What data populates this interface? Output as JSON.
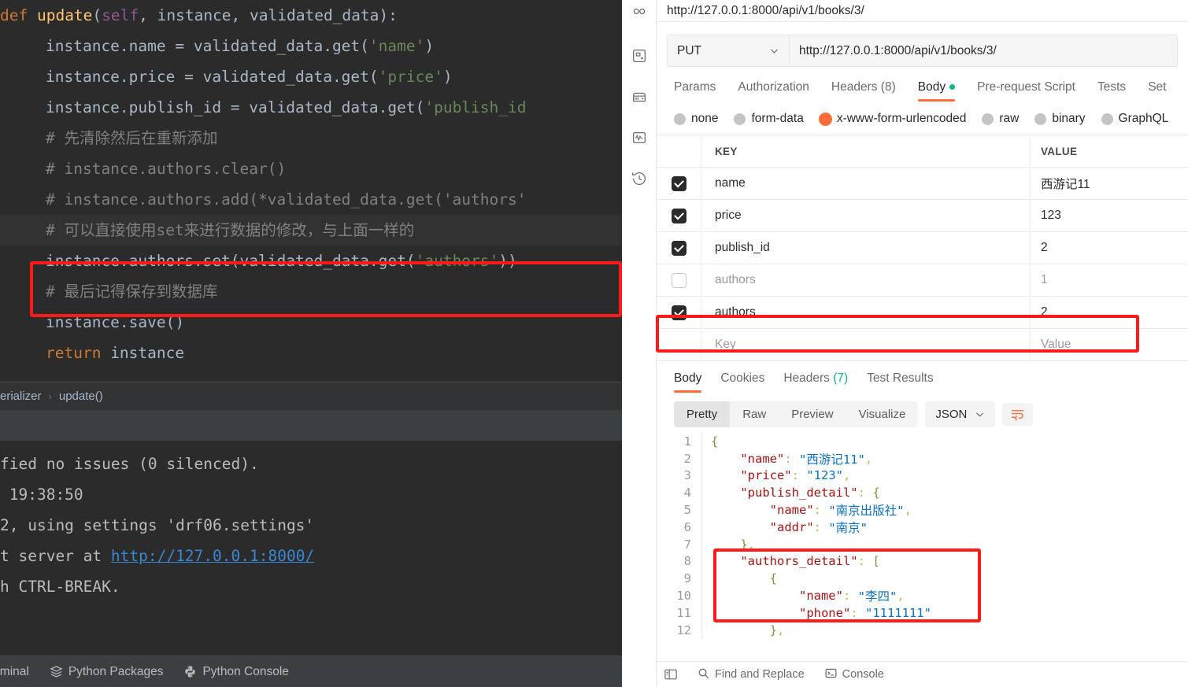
{
  "ide": {
    "code_lines": [
      {
        "indent": 0,
        "tokens": [
          {
            "t": "def ",
            "c": "kw"
          },
          {
            "t": "update",
            "c": "fn"
          },
          {
            "t": "(",
            "c": "pun"
          },
          {
            "t": "self",
            "c": "self"
          },
          {
            "t": ", instance, validated_data):",
            "c": "txt"
          }
        ]
      },
      {
        "indent": 1,
        "tokens": [
          {
            "t": "instance.name = validated_data.get(",
            "c": "txt"
          },
          {
            "t": "'name'",
            "c": "str"
          },
          {
            "t": ")",
            "c": "txt"
          }
        ]
      },
      {
        "indent": 1,
        "tokens": [
          {
            "t": "instance.price = validated_data.get(",
            "c": "txt"
          },
          {
            "t": "'price'",
            "c": "str"
          },
          {
            "t": ")",
            "c": "txt"
          }
        ]
      },
      {
        "indent": 1,
        "tokens": [
          {
            "t": "instance.publish_id = validated_data.get(",
            "c": "txt"
          },
          {
            "t": "'publish_id",
            "c": "str"
          }
        ]
      },
      {
        "indent": 1,
        "tokens": [
          {
            "t": "# 先清除然后在重新添加",
            "c": "cmt"
          }
        ]
      },
      {
        "indent": 1,
        "tokens": [
          {
            "t": "# instance.authors.clear()",
            "c": "cmt"
          }
        ]
      },
      {
        "indent": 1,
        "tokens": [
          {
            "t": "# instance.authors.add(*validated_data.get('authors'",
            "c": "cmt"
          }
        ]
      },
      {
        "indent": 1,
        "highlight": true,
        "tokens": [
          {
            "t": "# 可以直接使用set来进行数据的修改，与上面一样的",
            "c": "cmt"
          }
        ]
      },
      {
        "indent": 1,
        "tokens": [
          {
            "t": "instance.authors.set(validated_data.get(",
            "c": "txt"
          },
          {
            "t": "'authors'",
            "c": "str"
          },
          {
            "t": "))",
            "c": "txt"
          }
        ]
      },
      {
        "indent": 1,
        "tokens": [
          {
            "t": "# 最后记得保存到数据库",
            "c": "cmt"
          }
        ]
      },
      {
        "indent": 1,
        "tokens": [
          {
            "t": "instance.save()",
            "c": "txt"
          }
        ]
      },
      {
        "indent": 1,
        "tokens": [
          {
            "t": "return ",
            "c": "kw"
          },
          {
            "t": "instance",
            "c": "txt"
          }
        ]
      }
    ],
    "breadcrumb": {
      "parent": "erializer",
      "current": "update()"
    },
    "console_lines": [
      {
        "segments": [
          {
            "t": "fied no issues (0 silenced).",
            "link": false
          }
        ]
      },
      {
        "segments": [
          {
            "t": " 19:38:50",
            "link": false
          }
        ]
      },
      {
        "segments": [
          {
            "t": "2, using settings 'drf06.settings'",
            "link": false
          }
        ]
      },
      {
        "segments": [
          {
            "t": "t server at ",
            "link": false
          },
          {
            "t": "http://127.0.0.1:8000/",
            "link": true
          }
        ]
      },
      {
        "segments": [
          {
            "t": "h CTRL-BREAK.",
            "link": false
          }
        ]
      }
    ],
    "status_items": [
      {
        "label": "erminal",
        "icon": "terminal-icon"
      },
      {
        "label": "Python Packages",
        "icon": "packages-icon"
      },
      {
        "label": "Python Console",
        "icon": "python-icon"
      }
    ]
  },
  "postman": {
    "rail_icons": [
      "collections-icon",
      "api-icon",
      "environments-icon",
      "monitor-icon",
      "history-icon"
    ],
    "url_title": "http://127.0.0.1:8000/api/v1/books/3/",
    "request": {
      "method": "PUT",
      "url": "http://127.0.0.1:8000/api/v1/books/3/",
      "tabs": [
        {
          "label": "Params",
          "active": false
        },
        {
          "label": "Authorization",
          "active": false
        },
        {
          "label": "Headers",
          "count": "(8)",
          "active": false
        },
        {
          "label": "Body",
          "active": true,
          "dot": true
        },
        {
          "label": "Pre-request Script",
          "active": false
        },
        {
          "label": "Tests",
          "active": false
        },
        {
          "label": "Set",
          "active": false
        }
      ],
      "body_types": [
        {
          "label": "none",
          "selected": false
        },
        {
          "label": "form-data",
          "selected": false
        },
        {
          "label": "x-www-form-urlencoded",
          "selected": true
        },
        {
          "label": "raw",
          "selected": false
        },
        {
          "label": "binary",
          "selected": false
        },
        {
          "label": "GraphQL",
          "selected": false
        }
      ],
      "table": {
        "headers": {
          "key": "KEY",
          "value": "VALUE"
        },
        "rows": [
          {
            "checked": true,
            "key": "name",
            "value": "西游记11",
            "muted": false,
            "highlight": false
          },
          {
            "checked": true,
            "key": "price",
            "value": "123",
            "muted": false,
            "highlight": false
          },
          {
            "checked": true,
            "key": "publish_id",
            "value": "2",
            "muted": false,
            "highlight": false
          },
          {
            "checked": false,
            "key": "authors",
            "value": "1",
            "muted": true,
            "highlight": false
          },
          {
            "checked": true,
            "key": "authors",
            "value": "2",
            "muted": false,
            "highlight": true
          }
        ],
        "placeholder_row": {
          "key": "Key",
          "value": "Value"
        }
      }
    },
    "response": {
      "tabs": [
        {
          "label": "Body",
          "active": true
        },
        {
          "label": "Cookies",
          "active": false
        },
        {
          "label": "Headers",
          "count": "(7)",
          "active": false
        },
        {
          "label": "Test Results",
          "active": false
        }
      ],
      "view_modes": [
        {
          "label": "Pretty",
          "active": true
        },
        {
          "label": "Raw",
          "active": false
        },
        {
          "label": "Preview",
          "active": false
        },
        {
          "label": "Visualize",
          "active": false
        }
      ],
      "format_select": "JSON",
      "wrap_icon": "wrap-lines-icon",
      "json_lines": [
        {
          "n": "1",
          "segments": [
            {
              "t": "{",
              "c": "brk"
            }
          ]
        },
        {
          "n": "2",
          "segments": [
            {
              "t": "    ",
              "c": "pun"
            },
            {
              "t": "\"name\"",
              "c": "key"
            },
            {
              "t": ": ",
              "c": "pun"
            },
            {
              "t": "\"西游记11\"",
              "c": "str"
            },
            {
              "t": ",",
              "c": "pun"
            }
          ]
        },
        {
          "n": "3",
          "segments": [
            {
              "t": "    ",
              "c": "pun"
            },
            {
              "t": "\"price\"",
              "c": "key"
            },
            {
              "t": ": ",
              "c": "pun"
            },
            {
              "t": "\"123\"",
              "c": "str"
            },
            {
              "t": ",",
              "c": "pun"
            }
          ]
        },
        {
          "n": "4",
          "segments": [
            {
              "t": "    ",
              "c": "pun"
            },
            {
              "t": "\"publish_detail\"",
              "c": "key"
            },
            {
              "t": ": ",
              "c": "pun"
            },
            {
              "t": "{",
              "c": "brk"
            }
          ]
        },
        {
          "n": "5",
          "segments": [
            {
              "t": "        ",
              "c": "pun"
            },
            {
              "t": "\"name\"",
              "c": "key"
            },
            {
              "t": ": ",
              "c": "pun"
            },
            {
              "t": "\"南京出版社\"",
              "c": "str"
            },
            {
              "t": ",",
              "c": "pun"
            }
          ]
        },
        {
          "n": "6",
          "segments": [
            {
              "t": "        ",
              "c": "pun"
            },
            {
              "t": "\"addr\"",
              "c": "key"
            },
            {
              "t": ": ",
              "c": "pun"
            },
            {
              "t": "\"南京\"",
              "c": "str"
            }
          ]
        },
        {
          "n": "7",
          "segments": [
            {
              "t": "    ",
              "c": "pun"
            },
            {
              "t": "}",
              "c": "brk"
            },
            {
              "t": ",",
              "c": "pun"
            }
          ]
        },
        {
          "n": "8",
          "segments": [
            {
              "t": "    ",
              "c": "pun"
            },
            {
              "t": "\"authors_detail\"",
              "c": "key"
            },
            {
              "t": ": ",
              "c": "pun"
            },
            {
              "t": "[",
              "c": "brk"
            }
          ]
        },
        {
          "n": "9",
          "segments": [
            {
              "t": "        ",
              "c": "pun"
            },
            {
              "t": "{",
              "c": "brk"
            }
          ]
        },
        {
          "n": "10",
          "segments": [
            {
              "t": "            ",
              "c": "pun"
            },
            {
              "t": "\"name\"",
              "c": "key"
            },
            {
              "t": ": ",
              "c": "pun"
            },
            {
              "t": "\"李四\"",
              "c": "str"
            },
            {
              "t": ",",
              "c": "pun"
            }
          ]
        },
        {
          "n": "11",
          "segments": [
            {
              "t": "            ",
              "c": "pun"
            },
            {
              "t": "\"phone\"",
              "c": "key"
            },
            {
              "t": ": ",
              "c": "pun"
            },
            {
              "t": "\"1111111\"",
              "c": "str"
            }
          ]
        },
        {
          "n": "12",
          "segments": [
            {
              "t": "        ",
              "c": "pun"
            },
            {
              "t": "}",
              "c": "brk"
            },
            {
              "t": ",",
              "c": "pun"
            }
          ]
        }
      ]
    },
    "status_items": [
      {
        "label": "Find and Replace",
        "icon": "search-icon"
      },
      {
        "label": "Console",
        "icon": "console-icon"
      }
    ],
    "sidebar_toggle_icon": "sidebar-toggle-icon"
  },
  "annotations": {
    "accent_red": "#ff1a1a",
    "accent_orange": "#ff6c37"
  }
}
